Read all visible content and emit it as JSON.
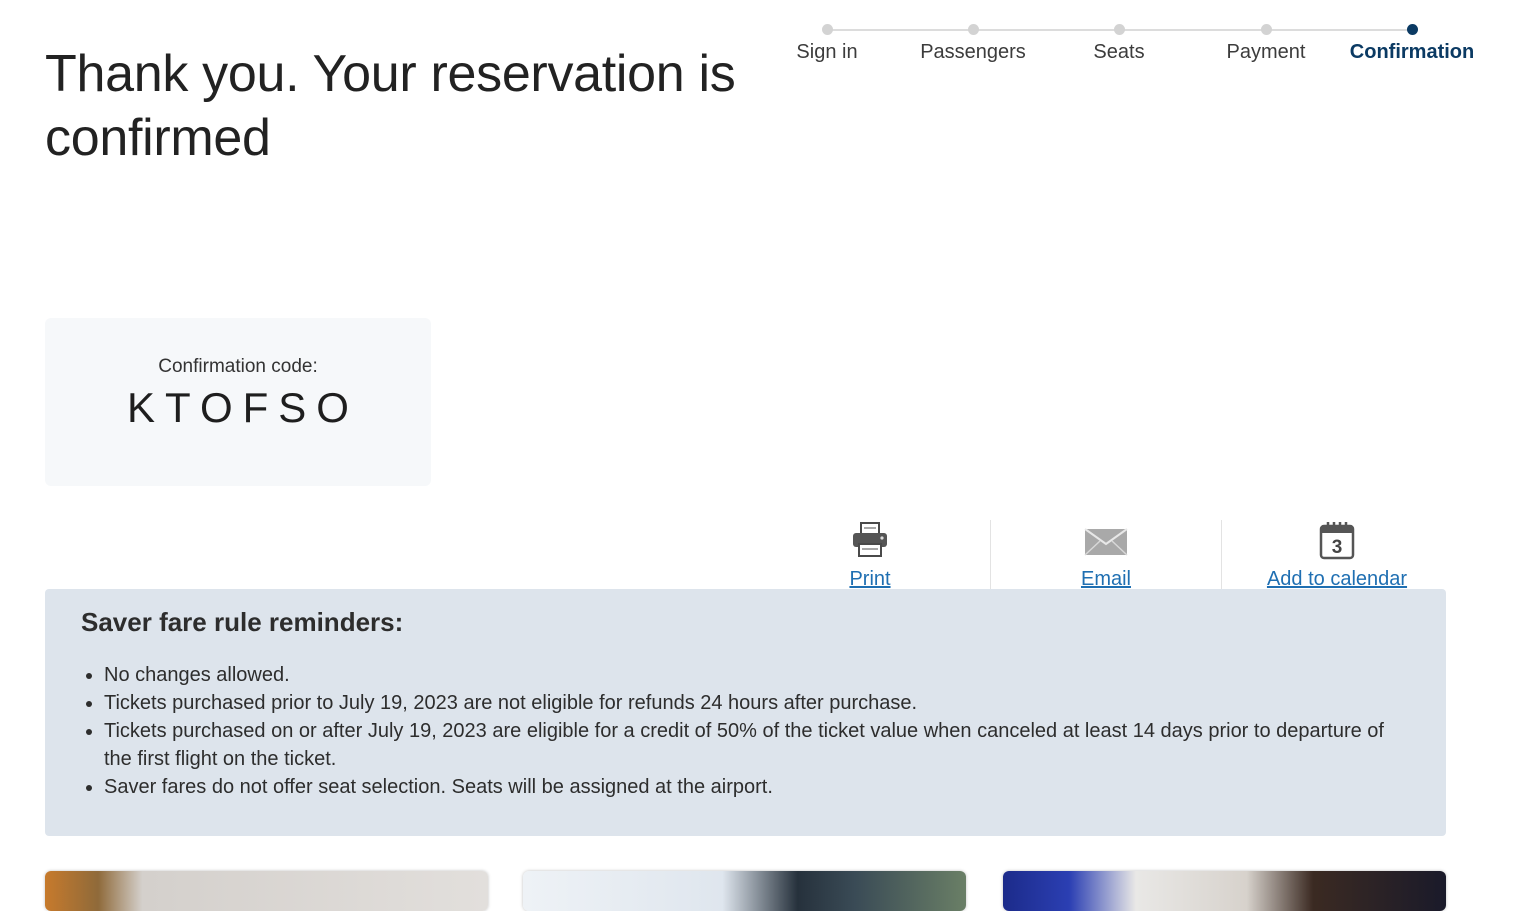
{
  "page": {
    "title": "Thank you. Your reservation is confirmed"
  },
  "progress": {
    "steps": [
      {
        "label": "Sign in",
        "active": false
      },
      {
        "label": "Passengers",
        "active": false
      },
      {
        "label": "Seats",
        "active": false
      },
      {
        "label": "Payment",
        "active": false
      },
      {
        "label": "Confirmation",
        "active": true
      }
    ],
    "active_color": "#0b3a63"
  },
  "confirmation": {
    "label": "Confirmation code:",
    "code": "KTOFSO"
  },
  "actions": [
    {
      "label": "Print",
      "icon": "printer-icon"
    },
    {
      "label": "Email",
      "icon": "envelope-icon"
    },
    {
      "label": "Add to calendar",
      "icon": "calendar-icon",
      "calendar_day": "3"
    }
  ],
  "rules": {
    "heading": "Saver fare rule reminders:",
    "items": [
      "No changes allowed.",
      "Tickets purchased prior to July 19, 2023 are not eligible for refunds 24 hours after purchase.",
      "Tickets purchased on or after July 19, 2023 are eligible for a credit of 50% of the ticket value when canceled at least 14 days prior to departure of the first flight on the ticket.",
      "Saver fares do not offer seat selection. Seats will be assigned at the airport."
    ]
  },
  "promo_cards": [
    {
      "image": "palm-trees-photo"
    },
    {
      "image": "aircraft-mountain-photo"
    },
    {
      "image": "travelers-photo"
    }
  ],
  "colors": {
    "link": "#1f6fb2",
    "panel_bg": "#dde4ec"
  }
}
